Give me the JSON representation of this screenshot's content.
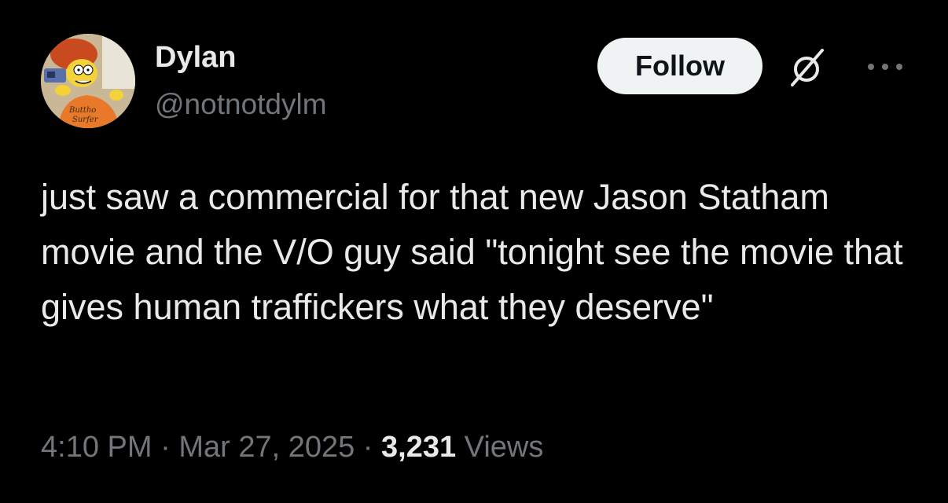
{
  "author": {
    "display_name": "Dylan",
    "handle": "@notnotdylm",
    "avatar_icon": "cartoon-character-avatar-icon"
  },
  "actions": {
    "follow_label": "Follow",
    "grok_icon": "grok-icon",
    "more_icon": "more-options-icon"
  },
  "tweet": {
    "text": "just saw a commercial for that new Jason Statham movie and the V/O guy said \"tonight see the movie that gives human traffickers what they deserve\""
  },
  "meta": {
    "time": "4:10 PM",
    "separator": " · ",
    "date": "Mar 27, 2025",
    "views_count": "3,231",
    "views_label": "Views"
  },
  "colors": {
    "background": "#000000",
    "primary_text": "#e7e9ea",
    "secondary_text": "#71767b",
    "follow_bg": "#eff3f4",
    "follow_text": "#0f1419"
  }
}
